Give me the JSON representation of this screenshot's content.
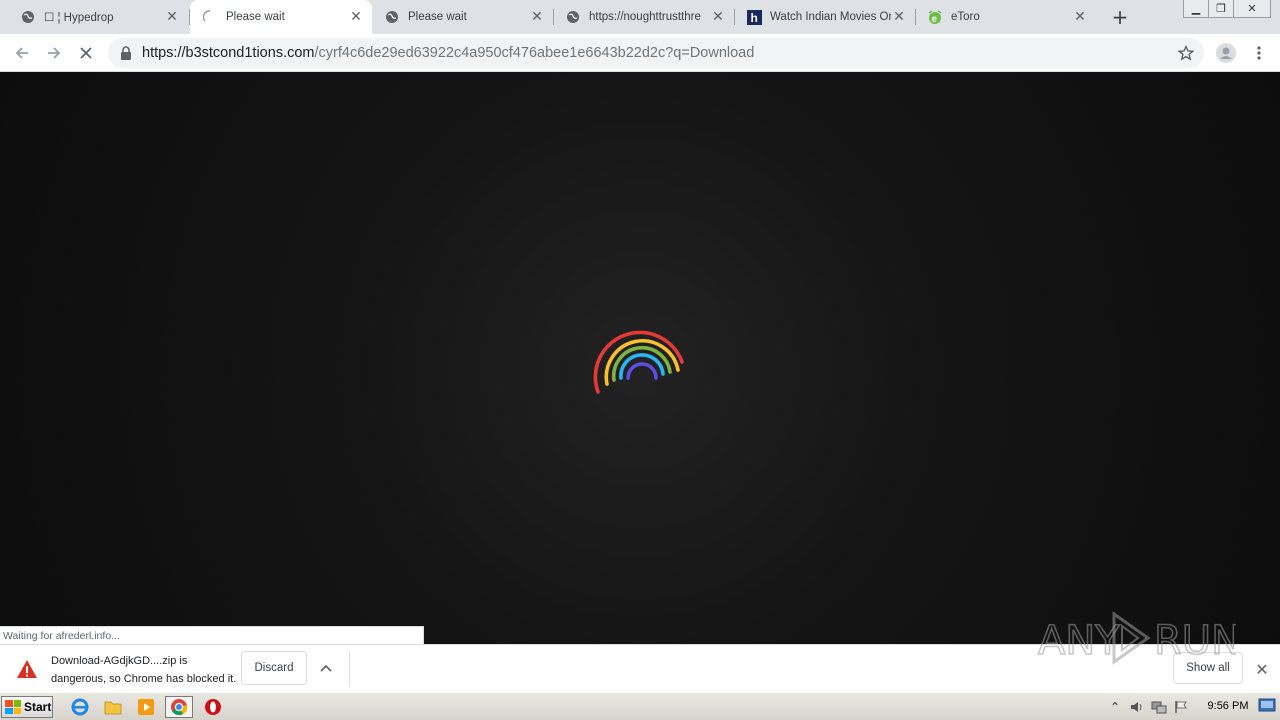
{
  "browser": {
    "tabs": [
      {
        "title": "☐ ¦ Hypedrop",
        "favicon": "globe-icon",
        "active": false
      },
      {
        "title": "Please wait",
        "favicon": "loading-spinner-icon",
        "active": true
      },
      {
        "title": "Please wait",
        "favicon": "globe-icon",
        "active": false
      },
      {
        "title": "https://noughttrustthre",
        "favicon": "globe-icon",
        "active": false
      },
      {
        "title": "Watch Indian Movies On",
        "favicon": "h-logo-icon",
        "active": false
      },
      {
        "title": "eToro",
        "favicon": "etoro-logo-icon",
        "active": false
      }
    ],
    "url_host": "https://b3stcond1tions.com",
    "url_path": "/cyrf4c6de29ed63922c4a950cf476abee1e6643b22d2c?q=Download",
    "status_text": "Waiting for afrederl.info...",
    "download_shelf": {
      "message_line1": "Download-AGdjkGD....zip is",
      "message_line2": "dangerous, so Chrome has blocked it.",
      "discard_label": "Discard",
      "show_all_label": "Show all"
    }
  },
  "watermark": {
    "text": "ANY RUN"
  },
  "taskbar": {
    "start_label": "Start",
    "clock": "9:56 PM",
    "apps": [
      "internet-explorer-icon",
      "file-explorer-icon",
      "media-player-icon",
      "chrome-icon",
      "opera-icon"
    ]
  },
  "colors": {
    "spinner": [
      "#e53935",
      "#fbc02d",
      "#7cb342",
      "#29b6f6",
      "#5c4ee5"
    ],
    "accent": "#1a73e8"
  }
}
